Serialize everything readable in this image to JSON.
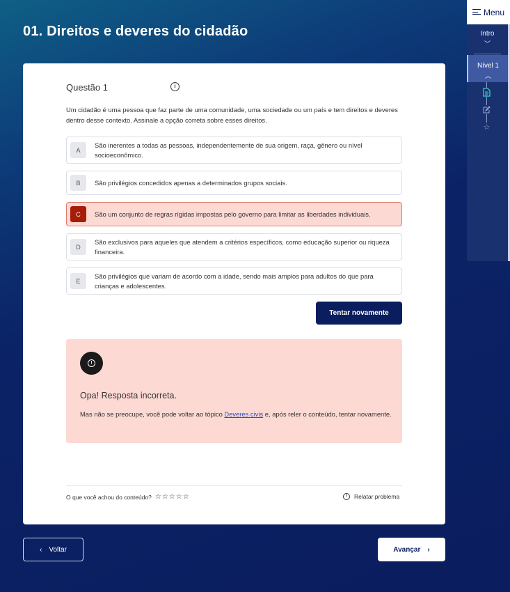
{
  "page": {
    "title": "01. Direitos e deveres do cidadão"
  },
  "nav": {
    "menu_label": "Menu",
    "intro_label": "Intro",
    "level_label": "Nível 1"
  },
  "question": {
    "heading": "Questão 1",
    "prompt": "Um cidadão é uma pessoa que faz parte de uma comunidade, uma sociedade ou um país e tem direitos e deveres dentro desse contexto. Assinale a opção correta sobre esses direitos.",
    "options": [
      {
        "letter": "A",
        "text": "São inerentes a todas as pessoas, independentemente de sua origem, raça, gênero ou nível socioeconômico.",
        "state": "default"
      },
      {
        "letter": "B",
        "text": "São privilégios concedidos apenas a determinados grupos sociais.",
        "state": "default"
      },
      {
        "letter": "C",
        "text": "São um conjunto de regras rígidas impostas pelo governo para limitar as liberdades individuais.",
        "state": "wrong"
      },
      {
        "letter": "D",
        "text": "São exclusivos para aqueles que atendem a critérios específicos, como educação superior ou riqueza financeira.",
        "state": "default"
      },
      {
        "letter": "E",
        "text": "São privilégios que variam de acordo com a idade, sendo mais amplos para adultos do que para crianças e adolescentes.",
        "state": "default"
      }
    ],
    "retry_label": "Tentar novamente"
  },
  "feedback": {
    "title": "Opa! Resposta incorreta.",
    "body_before": "Mas não se preocupe, você pode voltar ao tópico ",
    "link_text": "Deveres civis",
    "body_after": " e, após reler o conteúdo, tentar novamente."
  },
  "footer": {
    "rating_prompt": "O que você achou do conteúdo?",
    "stars_total": 5,
    "report_label": "Relatar problema"
  },
  "navigation": {
    "back_label": "Voltar",
    "next_label": "Avançar"
  },
  "colors": {
    "navy": "#0a1d5e",
    "wrong_fill": "#fdd9d3",
    "wrong_badge": "#a71d08",
    "link": "#2c4fc7"
  }
}
